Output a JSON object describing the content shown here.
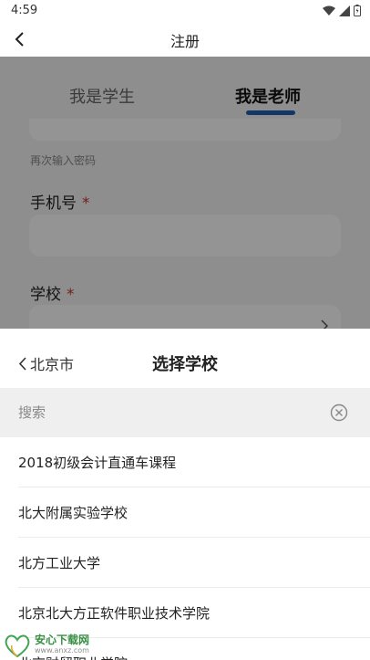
{
  "status_bar": {
    "time": "4:59"
  },
  "nav": {
    "title": "注册"
  },
  "form": {
    "tabs": [
      {
        "label": "我是学生",
        "active": false
      },
      {
        "label": "我是老师",
        "active": true
      }
    ],
    "confirm_password_hint": "再次输入密码",
    "phone_label": "手机号",
    "school_label": "学校",
    "required_mark": "*"
  },
  "sheet": {
    "city": "北京市",
    "title": "选择学校",
    "search_placeholder": "搜索",
    "schools": [
      "2018初级会计直通车课程",
      "北大附属实验学校",
      "北方工业大学",
      "北京北大方正软件职业技术学院",
      "北京财贸职业学院"
    ]
  },
  "watermark": {
    "brand": "安心下载网",
    "site": "www.anxz.com"
  },
  "colors": {
    "accent": "#1f5fb0",
    "required": "#c0392b",
    "overlay": "rgba(0,0,0,0.42)"
  }
}
